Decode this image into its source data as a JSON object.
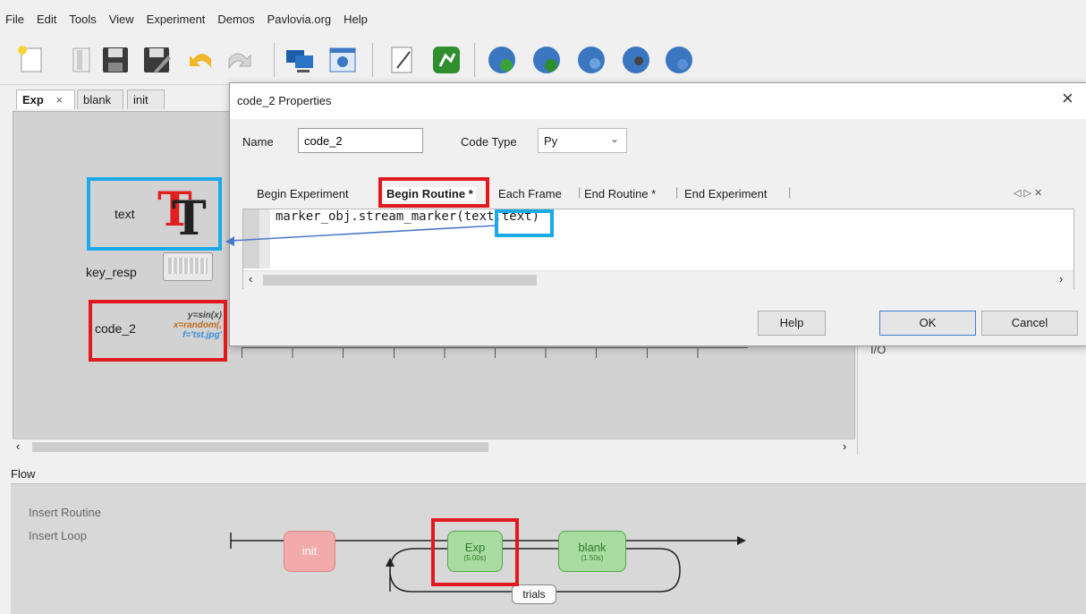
{
  "menu": [
    "File",
    "Edit",
    "Tools",
    "View",
    "Experiment",
    "Demos",
    "Pavlovia.org",
    "Help"
  ],
  "routine_tabs": [
    {
      "label": "Exp",
      "close": "×",
      "active": true
    },
    {
      "label": "blank",
      "active": false
    },
    {
      "label": "init",
      "active": false
    }
  ],
  "components": {
    "text_label": "text",
    "key_resp_label": "key_resp",
    "code_label": "code_2",
    "code_icon_lines": [
      "y=sin(x)",
      "x=random(,",
      "f='tst.jpg'"
    ]
  },
  "right_pane_partial": "I/O",
  "flow": {
    "label": "Flow",
    "insert_routine": "Insert Routine",
    "insert_loop": "Insert Loop",
    "routines": [
      {
        "name": "init",
        "duration": ""
      },
      {
        "name": "Exp",
        "duration": "(5.00s)"
      },
      {
        "name": "blank",
        "duration": "(1.50s)"
      }
    ],
    "loop_label": "trials"
  },
  "dialog": {
    "title": "code_2 Properties",
    "close": "×",
    "name_label": "Name",
    "name_value": "code_2",
    "code_type_label": "Code Type",
    "code_type_value": "Py",
    "tabs": [
      "Begin Experiment",
      "Begin Routine *",
      "Each Frame",
      "End Routine *",
      "End Experiment"
    ],
    "tab_nav": "◁ ▷ ✕",
    "code": "marker_obj.stream_marker(text.text)",
    "help": "Help",
    "ok": "OK",
    "cancel": "Cancel"
  },
  "colors": {
    "highlight_red": "#e0191f",
    "highlight_blue": "#1ba9e8",
    "arrow": "#4a78c9",
    "routine_init": "#f2aaaa",
    "routine_green": "#a9dca0"
  }
}
